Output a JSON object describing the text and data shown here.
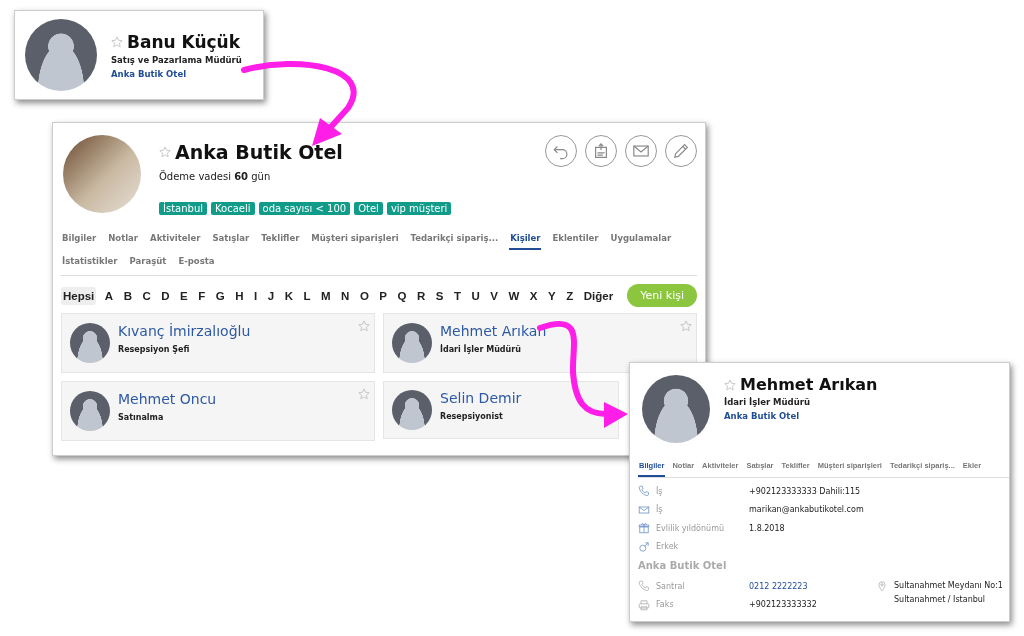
{
  "contact_card": {
    "name": "Banu Küçük",
    "starred": false,
    "title": "Satış ve Pazarlama Müdürü",
    "company": "Anka Butik Otel"
  },
  "company_window": {
    "name": "Anka Butik Otel",
    "starred": false,
    "payment_terms": "Ödeme vadesi **60** gün",
    "tags": [
      "İstanbul",
      "Kocaeli",
      "oda sayısı < 100",
      "Otel",
      "vip müşteri"
    ],
    "actions": [
      {
        "kind": "undo"
      },
      {
        "kind": "vcf"
      },
      {
        "kind": "mail"
      },
      {
        "kind": "edit"
      }
    ],
    "tabs": [
      {
        "label": "Bilgiler",
        "selected": false
      },
      {
        "label": "Notlar",
        "selected": false
      },
      {
        "label": "Aktiviteler",
        "selected": false
      },
      {
        "label": "Satışlar",
        "selected": false
      },
      {
        "label": "Teklifler",
        "selected": false
      },
      {
        "label": "Müşteri siparişleri",
        "selected": false
      },
      {
        "label": "Tedarikçi sipariş...",
        "selected": false
      },
      {
        "label": "Kişiler",
        "selected": true
      },
      {
        "label": "Eklentiler",
        "selected": false
      },
      {
        "label": "Uygulamalar",
        "selected": false
      },
      {
        "label": "İstatistikler",
        "selected": false
      },
      {
        "label": "Paraşüt",
        "selected": false
      },
      {
        "label": "E-posta",
        "selected": false
      }
    ],
    "letters": [
      {
        "label": "Hepsi",
        "selected": true
      },
      {
        "label": "A",
        "selected": false
      },
      {
        "label": "B",
        "selected": false
      },
      {
        "label": "C",
        "selected": false
      },
      {
        "label": "D",
        "selected": false
      },
      {
        "label": "E",
        "selected": false
      },
      {
        "label": "F",
        "selected": false
      },
      {
        "label": "G",
        "selected": false
      },
      {
        "label": "H",
        "selected": false
      },
      {
        "label": "I",
        "selected": false
      },
      {
        "label": "J",
        "selected": false
      },
      {
        "label": "K",
        "selected": false
      },
      {
        "label": "L",
        "selected": false
      },
      {
        "label": "M",
        "selected": false
      },
      {
        "label": "N",
        "selected": false
      },
      {
        "label": "O",
        "selected": false
      },
      {
        "label": "P",
        "selected": false
      },
      {
        "label": "Q",
        "selected": false
      },
      {
        "label": "R",
        "selected": false
      },
      {
        "label": "S",
        "selected": false
      },
      {
        "label": "T",
        "selected": false
      },
      {
        "label": "U",
        "selected": false
      },
      {
        "label": "V",
        "selected": false
      },
      {
        "label": "W",
        "selected": false
      },
      {
        "label": "X",
        "selected": false
      },
      {
        "label": "Y",
        "selected": false
      },
      {
        "label": "Z",
        "selected": false
      },
      {
        "label": "Diğer",
        "selected": false
      }
    ],
    "new_button": "Yeni kişi",
    "contacts": [
      {
        "name": "Kıvanç İmirzalıoğlu",
        "role": "Resepsiyon Şefi",
        "starred": false
      },
      {
        "name": "Mehmet Arıkan",
        "role": "İdari İşler Müdürü",
        "starred": false
      },
      {
        "name": "Mehmet Oncu",
        "role": "Satınalma",
        "starred": false
      },
      {
        "name": "Selin Demir",
        "role": "Resepsiyonist"
      }
    ]
  },
  "contact_window": {
    "name": "Mehmet Arıkan",
    "starred": false,
    "title": "İdari İşler Müdürü",
    "company": "Anka Butik Otel",
    "tabs": [
      {
        "label": "Bilgiler",
        "selected": true
      },
      {
        "label": "Notlar",
        "selected": false
      },
      {
        "label": "Aktiviteler",
        "selected": false
      },
      {
        "label": "Satışlar",
        "selected": false
      },
      {
        "label": "Teklifler",
        "selected": false
      },
      {
        "label": "Müşteri siparişleri",
        "selected": false
      },
      {
        "label": "Tedarikçi sipariş...",
        "selected": false
      },
      {
        "label": "Ekler",
        "selected": false
      }
    ],
    "details": [
      {
        "kind": "phone",
        "label": "İş",
        "value": "+902123333333 Dahili:115"
      },
      {
        "kind": "mail",
        "label": "İş",
        "value": "marikan@ankabutikotel.com"
      },
      {
        "kind": "gift",
        "label": "Evlilik yıldönümü",
        "value": "1.8.2018"
      },
      {
        "kind": "male",
        "label": "Erkek"
      }
    ],
    "company_section": {
      "name": "Anka Butik Otel",
      "rows": [
        {
          "kind": "phone",
          "label": "Santral",
          "value": "0212 2222223"
        },
        {
          "kind": "fax",
          "label": "Faks",
          "value": "+902123333332"
        }
      ],
      "address": [
        "Sultanahmet Meydanı No:1",
        "Sultanahmet / Istanbul"
      ]
    }
  }
}
